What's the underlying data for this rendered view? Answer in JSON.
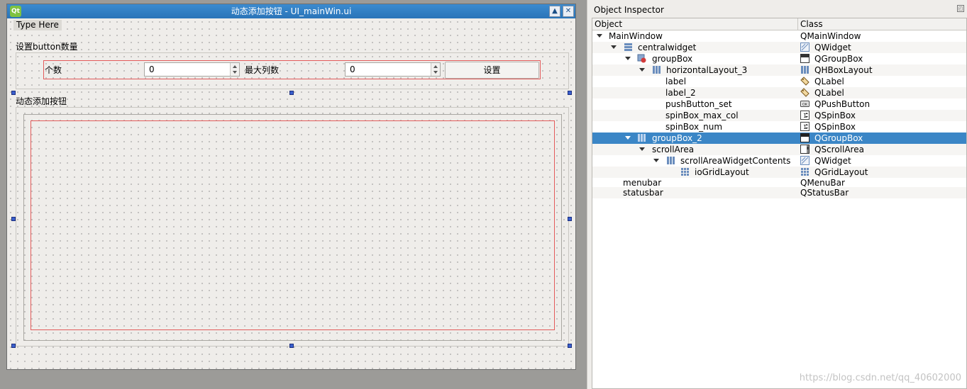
{
  "form_window": {
    "title": "动态添加按钮 - UI_mainWin.ui",
    "menu_placeholder": "Type Here",
    "group_box_top": {
      "title": "设置button数量",
      "label_count": "个数",
      "spin_num_value": "0",
      "label_max_col": "最大列数",
      "spin_max_col_value": "0",
      "button_set": "设置"
    },
    "group_box_bottom": {
      "title": "动态添加按钮"
    }
  },
  "inspector": {
    "title": "Object Inspector",
    "columns": [
      "Object",
      "Class"
    ],
    "rows": [
      {
        "object": "MainWindow",
        "class": "QMainWindow",
        "icon": "none"
      },
      {
        "object": "centralwidget",
        "class": "QWidget",
        "icon": "layout-vertical-icon"
      },
      {
        "object": "groupBox",
        "class": "QGroupBox",
        "icon": "broken-layout-icon"
      },
      {
        "object": "horizontalLayout_3",
        "class": "QHBoxLayout",
        "icon": "hbox-layout-icon"
      },
      {
        "object": "label",
        "class": "QLabel",
        "icon": "none"
      },
      {
        "object": "label_2",
        "class": "QLabel",
        "icon": "none"
      },
      {
        "object": "pushButton_set",
        "class": "QPushButton",
        "icon": "none"
      },
      {
        "object": "spinBox_max_col",
        "class": "QSpinBox",
        "icon": "none"
      },
      {
        "object": "spinBox_num",
        "class": "QSpinBox",
        "icon": "none"
      },
      {
        "object": "groupBox_2",
        "class": "QGroupBox",
        "icon": "hbox-layout-icon"
      },
      {
        "object": "scrollArea",
        "class": "QScrollArea",
        "icon": "none"
      },
      {
        "object": "scrollAreaWidgetContents",
        "class": "QWidget",
        "icon": "hbox-layout-icon"
      },
      {
        "object": "ioGridLayout",
        "class": "QGridLayout",
        "icon": "grid-layout-icon"
      },
      {
        "object": "menubar",
        "class": "QMenuBar",
        "icon": "none"
      },
      {
        "object": "statusbar",
        "class": "QStatusBar",
        "icon": "none"
      }
    ],
    "selected_object": "groupBox_2"
  },
  "watermark": "https://blog.csdn.net/qq_40602000",
  "colors": {
    "selection": "#3b86c6",
    "titlebar": "#2a74b8",
    "layout_outline": "#e35b5b"
  }
}
